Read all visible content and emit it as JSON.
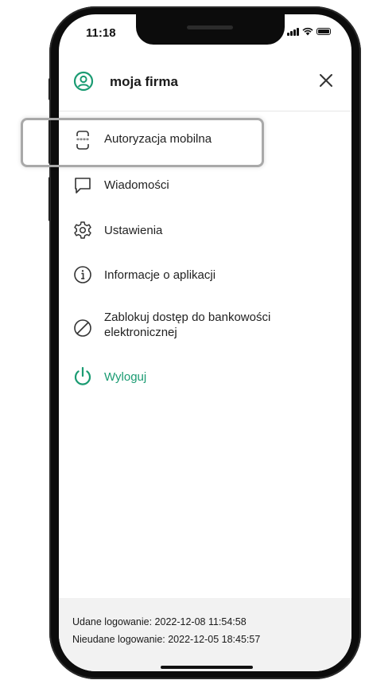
{
  "status_bar": {
    "time": "11:18"
  },
  "header": {
    "title": "moja firma"
  },
  "menu": [
    {
      "label": "Autoryzacja mobilna",
      "icon": "mobile-authorization-icon"
    },
    {
      "label": "Wiadomości",
      "icon": "message-icon"
    },
    {
      "label": "Ustawienia",
      "icon": "settings-gear-icon"
    },
    {
      "label": "Informacje o aplikacji",
      "icon": "info-icon"
    },
    {
      "label": "Zablokuj dostęp do bankowości",
      "label2": "elektronicznej",
      "icon": "block-icon"
    },
    {
      "label": "Wyloguj",
      "icon": "power-icon"
    }
  ],
  "footer": {
    "successful_login": "Udane logowanie: 2022-12-08 11:54:58",
    "failed_login": "Nieudane logowanie: 2022-12-05 18:45:57"
  },
  "colors": {
    "accent": "#1a9b72",
    "footer_bg": "#f2f2f2",
    "highlight": "#a9a9a9"
  }
}
